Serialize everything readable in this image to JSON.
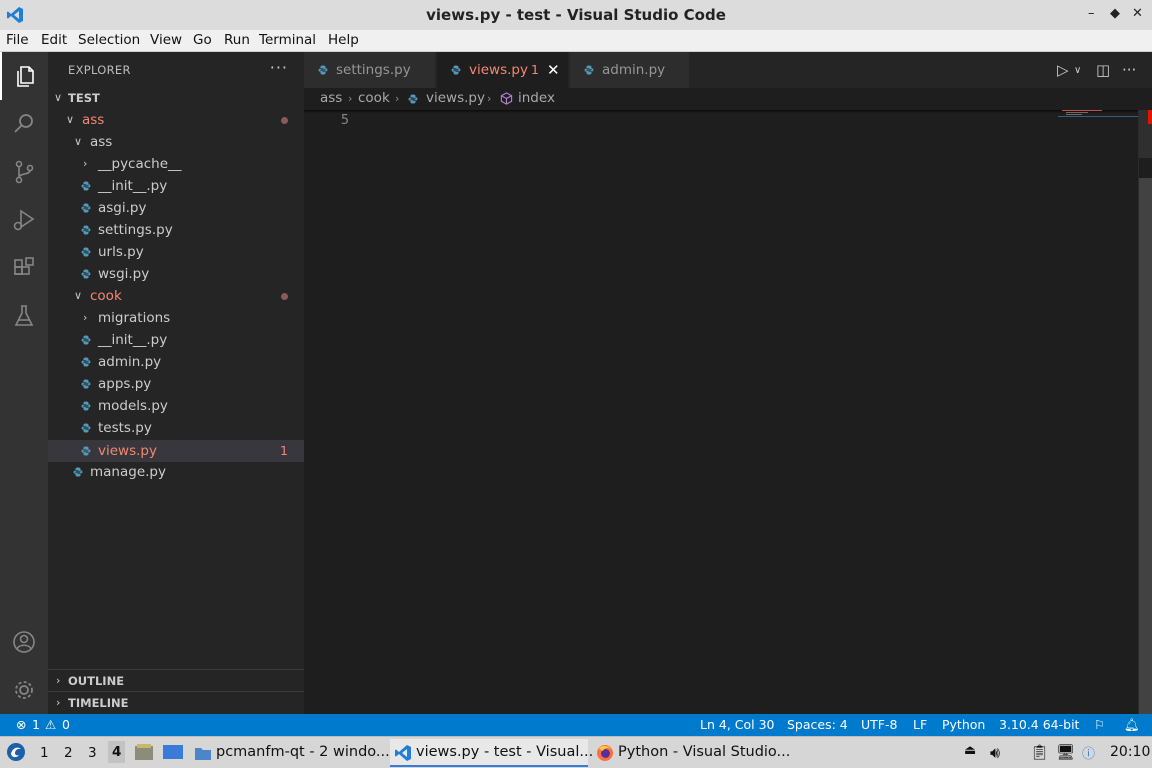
{
  "window": {
    "title": "views.py - test - Visual Studio Code",
    "controls": [
      "–",
      "◆",
      "✕"
    ]
  },
  "menu": [
    "File",
    "Edit",
    "Selection",
    "View",
    "Go",
    "Run",
    "Terminal",
    "Help"
  ],
  "sidebar": {
    "header": "EXPLORER",
    "more": "···",
    "root": "TEST",
    "tree": [
      {
        "label": "ass",
        "type": "folder",
        "modified": true
      },
      {
        "label": "ass",
        "type": "folder"
      },
      {
        "label": "__pycache__",
        "type": "folder-collapsed"
      },
      {
        "label": "__init__.py",
        "type": "file"
      },
      {
        "label": "asgi.py",
        "type": "file"
      },
      {
        "label": "settings.py",
        "type": "file"
      },
      {
        "label": "urls.py",
        "type": "file"
      },
      {
        "label": "wsgi.py",
        "type": "file"
      },
      {
        "label": "cook",
        "type": "folder",
        "modified": true
      },
      {
        "label": "migrations",
        "type": "folder-collapsed"
      },
      {
        "label": "__init__.py",
        "type": "file"
      },
      {
        "label": "admin.py",
        "type": "file"
      },
      {
        "label": "apps.py",
        "type": "file"
      },
      {
        "label": "models.py",
        "type": "file"
      },
      {
        "label": "tests.py",
        "type": "file"
      },
      {
        "label": "views.py",
        "type": "file",
        "badge": "1",
        "selected": true
      },
      {
        "label": "manage.py",
        "type": "file"
      }
    ],
    "outline": "OUTLINE",
    "timeline": "TIMELINE"
  },
  "tabs": [
    {
      "label": "settings.py"
    },
    {
      "label": "views.py",
      "count": "1",
      "close": "✕",
      "active": true
    },
    {
      "label": "admin.py"
    }
  ],
  "breadcrumb": {
    "parts": [
      "ass",
      "cook",
      "views.py",
      "index"
    ]
  },
  "editor": {
    "line_number": "5"
  },
  "status": {
    "errors": "1",
    "warnings": "0",
    "position": "Ln 4, Col 30",
    "spaces": "Spaces: 4",
    "encoding": "UTF-8",
    "eol": "LF",
    "language": "Python",
    "interpreter": "3.10.4 64-bit"
  },
  "taskbar": {
    "workspaces": [
      "1",
      "2",
      "3",
      "4"
    ],
    "tasks": [
      {
        "label": "pcmanfm-qt - 2 windo..."
      },
      {
        "label": "views.py - test - Visual..."
      },
      {
        "label": "Python - Visual Studio..."
      }
    ],
    "clock": "20:10"
  },
  "colors": {
    "accent": "#007acc",
    "error": "#f48771",
    "python": "#519aba"
  }
}
